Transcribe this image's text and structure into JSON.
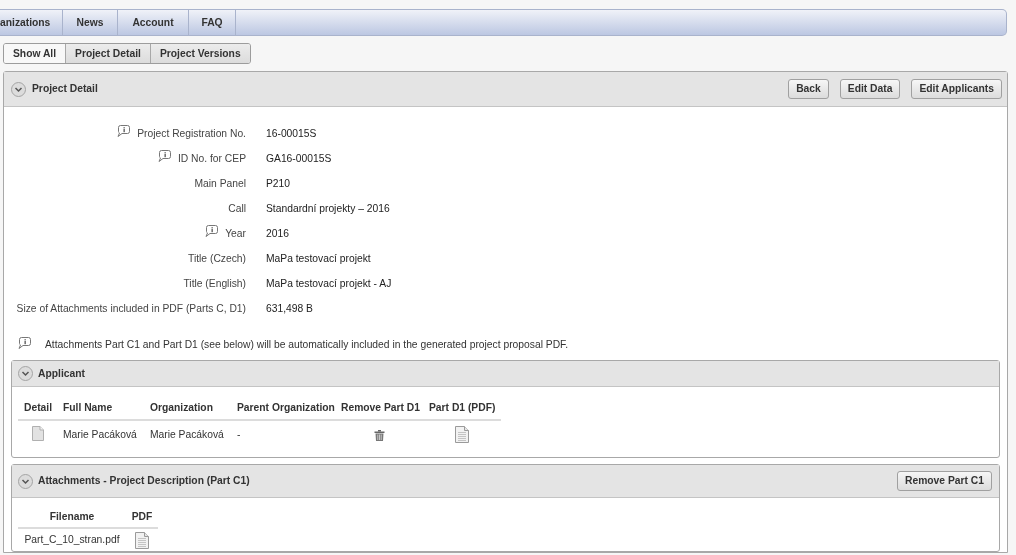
{
  "nav": {
    "tabs": [
      {
        "label": "anizations"
      },
      {
        "label": "News"
      },
      {
        "label": "Account"
      },
      {
        "label": "FAQ"
      }
    ]
  },
  "view_tabs": [
    {
      "label": "Show All",
      "selected": true
    },
    {
      "label": "Project Detail",
      "selected": false
    },
    {
      "label": "Project Versions",
      "selected": false
    }
  ],
  "project_panel": {
    "title": "Project Detail",
    "buttons": [
      "Back",
      "Edit Data",
      "Edit Applicants"
    ],
    "fields": [
      {
        "label": "Project Registration No.",
        "value": "16-00015S",
        "info": true
      },
      {
        "label": "ID No. for CEP",
        "value": "GA16-00015S",
        "info": true
      },
      {
        "label": "Main Panel",
        "value": "P210",
        "info": false
      },
      {
        "label": "Call",
        "value": "Standardní projekty – 2016",
        "info": false
      },
      {
        "label": "Year",
        "value": "2016",
        "info": true
      },
      {
        "label": "Title (Czech)",
        "value": "MaPa testovací projekt",
        "info": false
      },
      {
        "label": "Title (English)",
        "value": "MaPa testovací projekt - AJ",
        "info": false
      },
      {
        "label": "Size of Attachments included in PDF (Parts C, D1)",
        "value": "631,498 B",
        "info": false
      }
    ],
    "note": "Attachments Part C1 and Part D1 (see below) will be automatically included in the generated project proposal PDF."
  },
  "applicant": {
    "title": "Applicant",
    "columns": [
      "Detail",
      "Full Name",
      "Organization",
      "Parent Organization",
      "Remove Part D1",
      "Part D1 (PDF)"
    ],
    "rows": [
      {
        "full_name": "Marie Pacáková",
        "organization": "Marie Pacáková",
        "parent_organization": "-"
      }
    ]
  },
  "attachments": {
    "title": "Attachments - Project Description (Part C1)",
    "button": "Remove Part C1",
    "columns": [
      "Filename",
      "PDF"
    ],
    "rows": [
      {
        "filename": "Part_C_10_stran.pdf"
      }
    ]
  }
}
